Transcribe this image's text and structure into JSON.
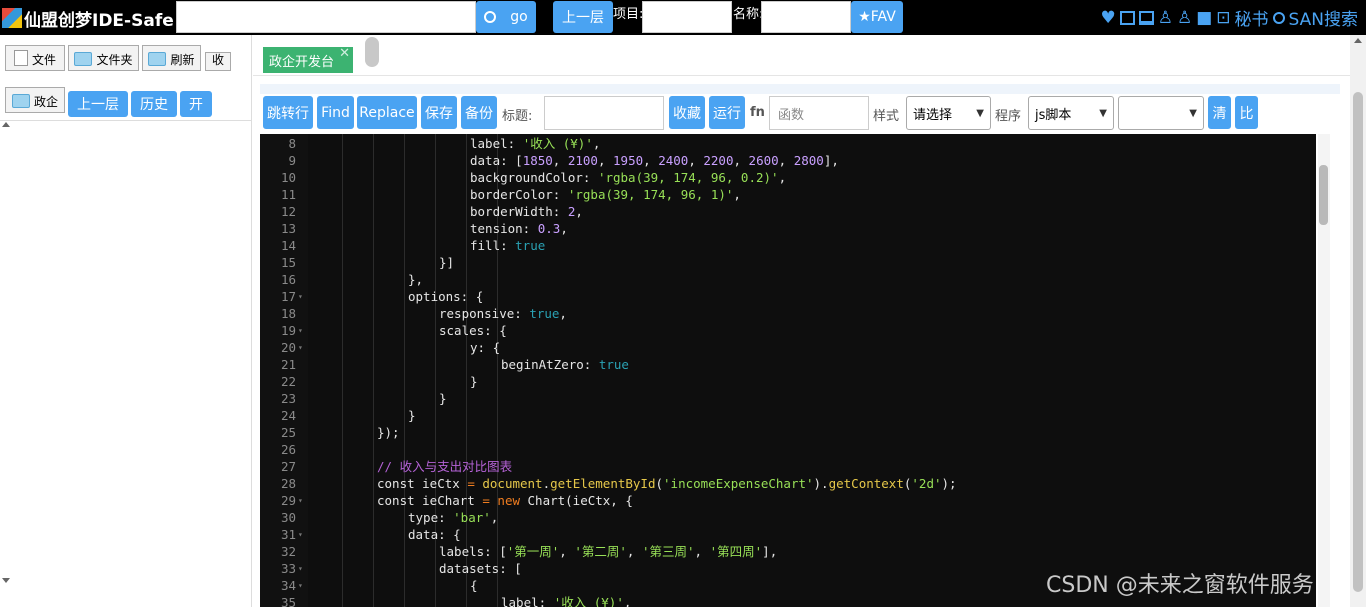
{
  "app": {
    "title": "仙盟创梦IDE-Safe"
  },
  "topbar": {
    "search_value": "",
    "go_label": "go",
    "up_label": "上一层",
    "project_label": "项目:",
    "project_value": "",
    "name_label": "名称:",
    "name_value": "",
    "fav_label": "★FAV",
    "secretary_label": "秘书",
    "san_search_label": "SAN搜索"
  },
  "left": {
    "file_label": "文件",
    "folder_label": "文件夹",
    "refresh_label": "刷新",
    "collapse_label": "收",
    "zhengqi_label": "政企",
    "up_label": "上一层",
    "history_label": "历史",
    "open_label": "开"
  },
  "tabs": [
    {
      "label": "政企开发台",
      "close": "✕"
    }
  ],
  "toolbar": {
    "goto_line": "跳转行",
    "find": "Find",
    "replace": "Replace",
    "save": "保存",
    "backup": "备份",
    "title_label": "标题:",
    "title_value": "",
    "collect": "收藏",
    "run": "运行",
    "fn_label": "fn",
    "fn_placeholder": "函数",
    "style_label": "样式",
    "style_select": "请选择",
    "program_label": "程序",
    "program_select": "js脚本",
    "extra_select": "",
    "clear": "清",
    "compare": "比"
  },
  "editor": {
    "lines": [
      {
        "n": "8",
        "fold": false,
        "indent": 5,
        "tokens": [
          [
            "p",
            "label: "
          ],
          [
            "s",
            "'收入 (¥)'"
          ],
          [
            "p",
            ","
          ]
        ]
      },
      {
        "n": "9",
        "fold": false,
        "indent": 5,
        "tokens": [
          [
            "p",
            "data: ["
          ],
          [
            "n",
            "1850"
          ],
          [
            "p",
            ", "
          ],
          [
            "n",
            "2100"
          ],
          [
            "p",
            ", "
          ],
          [
            "n",
            "1950"
          ],
          [
            "p",
            ", "
          ],
          [
            "n",
            "2400"
          ],
          [
            "p",
            ", "
          ],
          [
            "n",
            "2200"
          ],
          [
            "p",
            ", "
          ],
          [
            "n",
            "2600"
          ],
          [
            "p",
            ", "
          ],
          [
            "n",
            "2800"
          ],
          [
            "p",
            "],"
          ]
        ]
      },
      {
        "n": "10",
        "fold": false,
        "indent": 5,
        "tokens": [
          [
            "p",
            "backgroundColor: "
          ],
          [
            "s",
            "'rgba(39, 174, 96, 0.2)'"
          ],
          [
            "p",
            ","
          ]
        ]
      },
      {
        "n": "11",
        "fold": false,
        "indent": 5,
        "tokens": [
          [
            "p",
            "borderColor: "
          ],
          [
            "s",
            "'rgba(39, 174, 96, 1)'"
          ],
          [
            "p",
            ","
          ]
        ]
      },
      {
        "n": "12",
        "fold": false,
        "indent": 5,
        "tokens": [
          [
            "p",
            "borderWidth: "
          ],
          [
            "n",
            "2"
          ],
          [
            "p",
            ","
          ]
        ]
      },
      {
        "n": "13",
        "fold": false,
        "indent": 5,
        "tokens": [
          [
            "p",
            "tension: "
          ],
          [
            "n",
            "0.3"
          ],
          [
            "p",
            ","
          ]
        ]
      },
      {
        "n": "14",
        "fold": false,
        "indent": 5,
        "tokens": [
          [
            "p",
            "fill: "
          ],
          [
            "b",
            "true"
          ]
        ]
      },
      {
        "n": "15",
        "fold": false,
        "indent": 4,
        "tokens": [
          [
            "p",
            "}]"
          ]
        ]
      },
      {
        "n": "16",
        "fold": false,
        "indent": 3,
        "tokens": [
          [
            "p",
            "},"
          ]
        ]
      },
      {
        "n": "17",
        "fold": true,
        "indent": 3,
        "tokens": [
          [
            "p",
            "options: {"
          ]
        ]
      },
      {
        "n": "18",
        "fold": false,
        "indent": 4,
        "tokens": [
          [
            "p",
            "responsive: "
          ],
          [
            "b",
            "true"
          ],
          [
            "p",
            ","
          ]
        ]
      },
      {
        "n": "19",
        "fold": true,
        "indent": 4,
        "tokens": [
          [
            "p",
            "scales: {"
          ]
        ]
      },
      {
        "n": "20",
        "fold": true,
        "indent": 5,
        "tokens": [
          [
            "p",
            "y: {"
          ]
        ]
      },
      {
        "n": "21",
        "fold": false,
        "indent": 6,
        "tokens": [
          [
            "p",
            "beginAtZero: "
          ],
          [
            "b",
            "true"
          ]
        ]
      },
      {
        "n": "22",
        "fold": false,
        "indent": 5,
        "tokens": [
          [
            "p",
            "}"
          ]
        ]
      },
      {
        "n": "23",
        "fold": false,
        "indent": 4,
        "tokens": [
          [
            "p",
            "}"
          ]
        ]
      },
      {
        "n": "24",
        "fold": false,
        "indent": 3,
        "tokens": [
          [
            "p",
            "}"
          ]
        ]
      },
      {
        "n": "25",
        "fold": false,
        "indent": 2,
        "tokens": [
          [
            "p",
            "});"
          ]
        ]
      },
      {
        "n": "26",
        "fold": false,
        "indent": 2,
        "tokens": []
      },
      {
        "n": "27",
        "fold": false,
        "indent": 2,
        "tokens": [
          [
            "c",
            "// 收入与支出对比图表"
          ]
        ]
      },
      {
        "n": "28",
        "fold": false,
        "indent": 2,
        "tokens": [
          [
            "p",
            "const ieCtx "
          ],
          [
            "k",
            "="
          ],
          [
            "p",
            " "
          ],
          [
            "f",
            "document"
          ],
          [
            "p",
            "."
          ],
          [
            "f",
            "getElementById"
          ],
          [
            "p",
            "("
          ],
          [
            "s",
            "'incomeExpenseChart'"
          ],
          [
            "p",
            ")."
          ],
          [
            "f",
            "getContext"
          ],
          [
            "p",
            "("
          ],
          [
            "s",
            "'2d'"
          ],
          [
            "p",
            ");"
          ]
        ]
      },
      {
        "n": "29",
        "fold": true,
        "indent": 2,
        "tokens": [
          [
            "p",
            "const ieChart "
          ],
          [
            "k",
            "="
          ],
          [
            "p",
            " "
          ],
          [
            "k",
            "new"
          ],
          [
            "p",
            " Chart(ieCtx, {"
          ]
        ]
      },
      {
        "n": "30",
        "fold": false,
        "indent": 3,
        "tokens": [
          [
            "p",
            "type: "
          ],
          [
            "s",
            "'bar'"
          ],
          [
            "p",
            ","
          ]
        ]
      },
      {
        "n": "31",
        "fold": true,
        "indent": 3,
        "tokens": [
          [
            "p",
            "data: {"
          ]
        ]
      },
      {
        "n": "32",
        "fold": false,
        "indent": 4,
        "tokens": [
          [
            "p",
            "labels: ["
          ],
          [
            "s",
            "'第一周'"
          ],
          [
            "p",
            ", "
          ],
          [
            "s",
            "'第二周'"
          ],
          [
            "p",
            ", "
          ],
          [
            "s",
            "'第三周'"
          ],
          [
            "p",
            ", "
          ],
          [
            "s",
            "'第四周'"
          ],
          [
            "p",
            "],"
          ]
        ]
      },
      {
        "n": "33",
        "fold": true,
        "indent": 4,
        "tokens": [
          [
            "p",
            "datasets: ["
          ]
        ]
      },
      {
        "n": "34",
        "fold": true,
        "indent": 5,
        "tokens": [
          [
            "p",
            "{"
          ]
        ]
      },
      {
        "n": "35",
        "fold": false,
        "indent": 6,
        "tokens": [
          [
            "p",
            "label: "
          ],
          [
            "s",
            "'收入 (¥)'"
          ],
          [
            "p",
            ","
          ]
        ]
      }
    ]
  },
  "watermark": "CSDN @未来之窗软件服务",
  "icons": [
    "heart-icon",
    "panel-icon",
    "layout-icon",
    "user-icon",
    "user-icon",
    "folder-icon",
    "briefcase-icon",
    "search-icon"
  ]
}
